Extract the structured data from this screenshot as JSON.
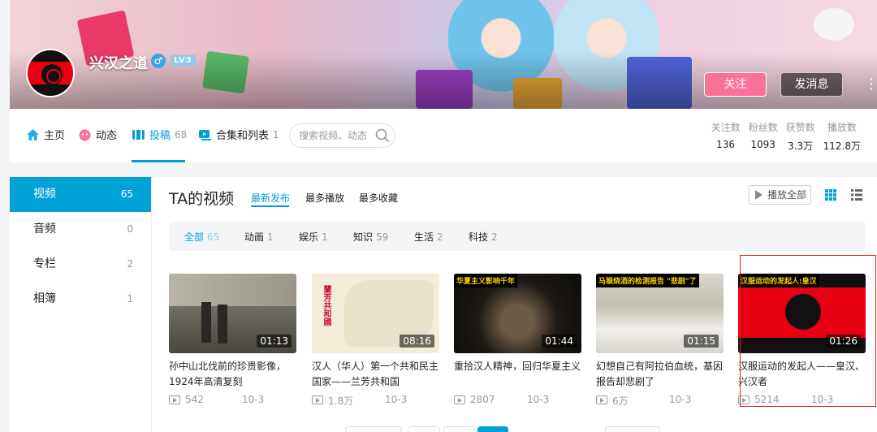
{
  "header": {
    "username": "兴汉之道",
    "gender_icon": "male-icon",
    "level": "LV3",
    "follow_label": "关注",
    "message_label": "发消息",
    "more_icon": "more-vertical-icon",
    "colors": {
      "accent": "#00a1d6",
      "follow": "#fb7299"
    }
  },
  "nav": {
    "items": [
      {
        "label": "主页",
        "icon": "home-icon"
      },
      {
        "label": "动态",
        "icon": "dynamic-icon"
      },
      {
        "label": "投稿",
        "count": "68",
        "icon": "upload-icon"
      },
      {
        "label": "合集和列表",
        "count": "1",
        "icon": "collection-icon"
      }
    ],
    "active_index": 2,
    "search_placeholder": "搜索视频、动态"
  },
  "stats": [
    {
      "label": "关注数",
      "value": "136"
    },
    {
      "label": "粉丝数",
      "value": "1093"
    },
    {
      "label": "获赞数",
      "value": "3.3万"
    },
    {
      "label": "播放数",
      "value": "112.8万"
    }
  ],
  "sidebar": {
    "items": [
      {
        "label": "视频",
        "count": "65"
      },
      {
        "label": "音频",
        "count": "0"
      },
      {
        "label": "专栏",
        "count": "2"
      },
      {
        "label": "相簿",
        "count": "1"
      }
    ]
  },
  "main": {
    "title": "TA的视频",
    "sort_tabs": [
      "最新发布",
      "最多播放",
      "最多收藏"
    ],
    "play_all_label": "播放全部",
    "categories": [
      {
        "label": "全部",
        "count": "65"
      },
      {
        "label": "动画",
        "count": "1"
      },
      {
        "label": "娱乐",
        "count": "1"
      },
      {
        "label": "知识",
        "count": "59"
      },
      {
        "label": "生活",
        "count": "2"
      },
      {
        "label": "科技",
        "count": "2"
      }
    ],
    "videos": [
      {
        "title": "孙中山北伐前的珍贵影像，1924年高清复刻",
        "duration": "01:13",
        "views": "542",
        "date": "10-3"
      },
      {
        "title": "汉人（华人）第一个共和民主国家——兰芳共和国",
        "duration": "08:16",
        "views": "1.8万",
        "date": "10-3",
        "thumb_text": "蘭芳共和國"
      },
      {
        "title": "重拾汉人精神，回归华夏主义",
        "duration": "01:44",
        "views": "2807",
        "date": "10-3",
        "thumb_text": "华夏主义影响千年"
      },
      {
        "title": "幻想自己有阿拉伯血统，基因报告却悲剧了",
        "duration": "01:15",
        "views": "6万",
        "date": "10-3",
        "thumb_text": "马猴烧酒的检测报告 \"悲剧\"了"
      },
      {
        "title": "汉服运动的发起人——皇汉、兴汉者",
        "duration": "01:26",
        "views": "5214",
        "date": "10-3",
        "thumb_text": "汉服运动的发起人:皇汉"
      }
    ]
  }
}
